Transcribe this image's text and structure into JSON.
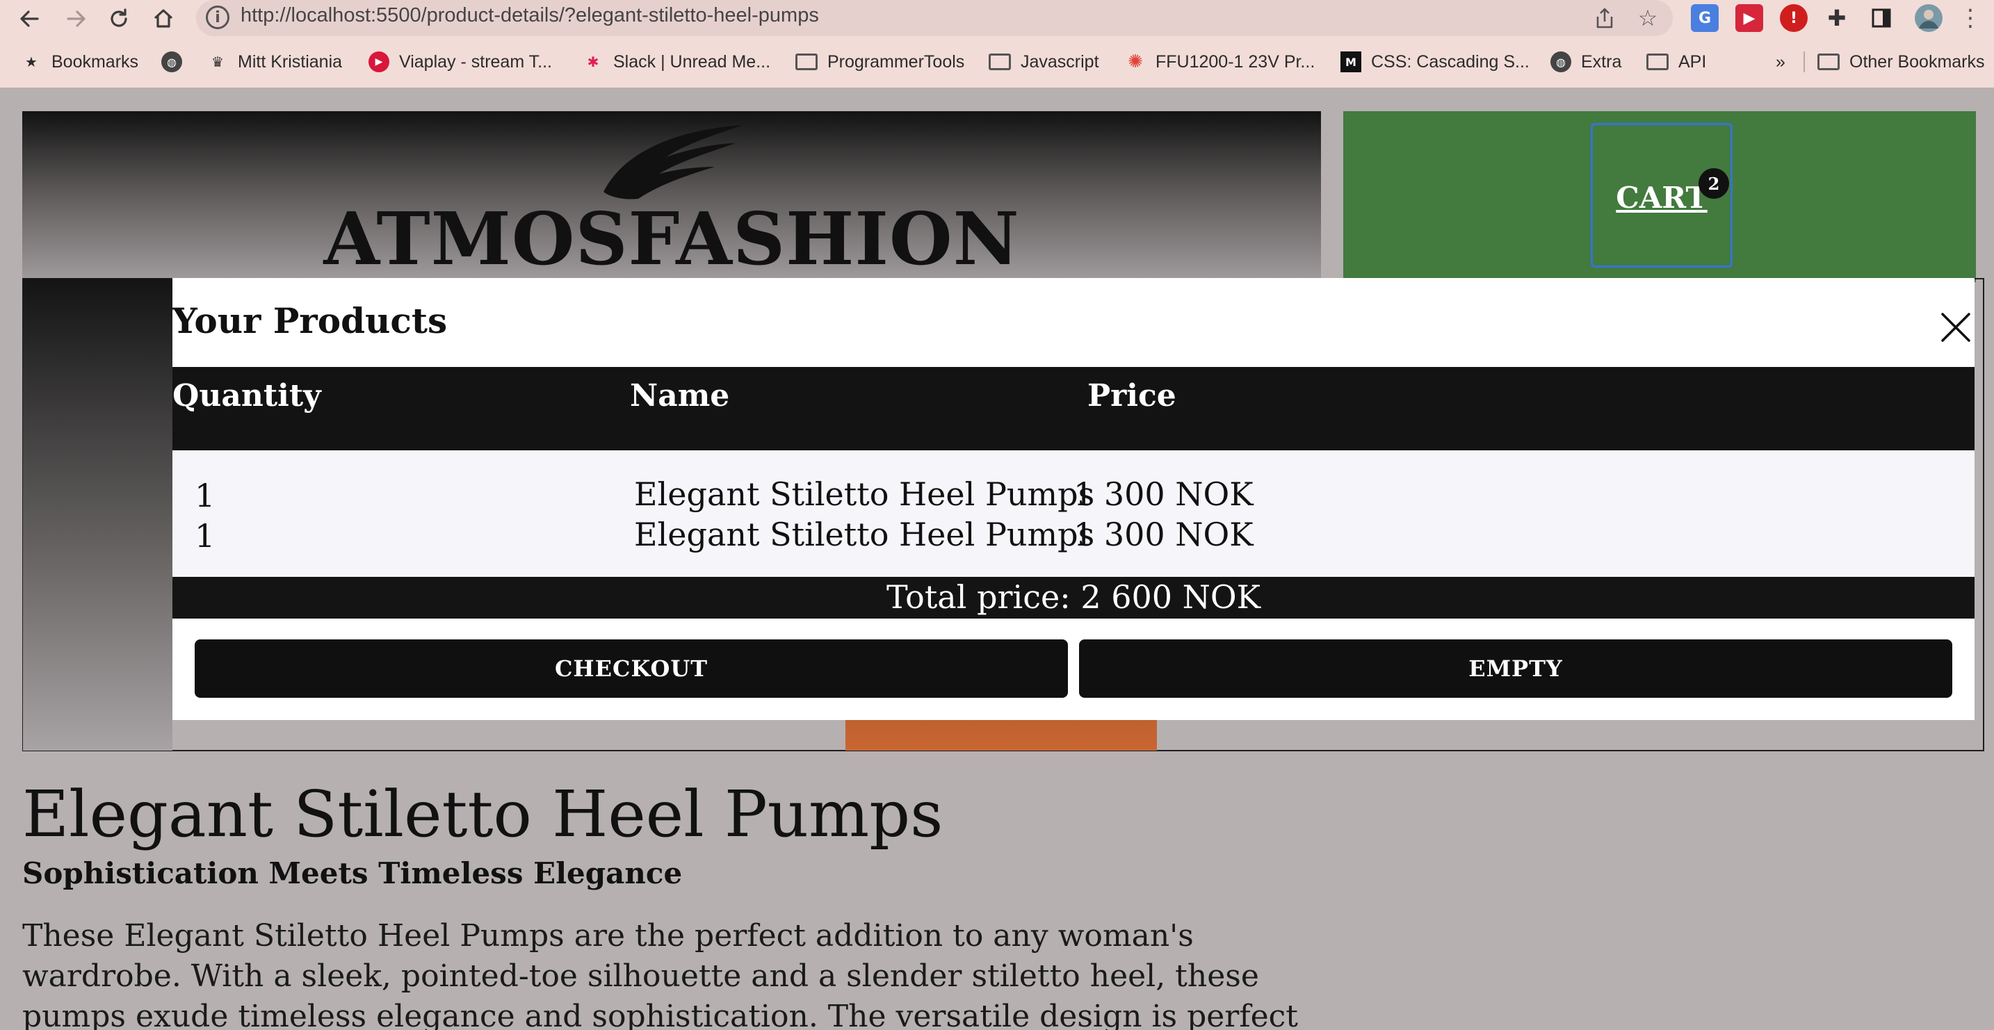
{
  "browser": {
    "url": "http://localhost:5500/product-details/?elegant-stiletto-heel-pumps",
    "nav_icons": [
      "back-arrow-icon",
      "forward-arrow-icon",
      "reload-icon",
      "home-icon"
    ],
    "bookmarks": [
      {
        "label": "Bookmarks",
        "icon": "star-icon"
      },
      {
        "label": "",
        "icon": "globe-icon"
      },
      {
        "label": "Mitt Kristiania",
        "icon": "kristiania-icon"
      },
      {
        "label": "Viaplay - stream T...",
        "icon": "viaplay-icon"
      },
      {
        "label": "Slack | Unread Me...",
        "icon": "slack-icon"
      },
      {
        "label": "ProgrammerTools",
        "icon": "folder-icon"
      },
      {
        "label": "Javascript",
        "icon": "folder-icon"
      },
      {
        "label": "FFU1200-1 23V Pr...",
        "icon": "canvas-icon"
      },
      {
        "label": "CSS: Cascading S...",
        "icon": "mdn-icon"
      },
      {
        "label": "Extra",
        "icon": "globe-icon"
      },
      {
        "label": "API",
        "icon": "folder-icon"
      }
    ],
    "overflow_label": "»",
    "other_bookmarks": "Other Bookmarks"
  },
  "site": {
    "logo_text": "ATMOSFASHION",
    "cart_label": "CART",
    "cart_count": "2"
  },
  "cart_modal": {
    "title": "Your Products",
    "headers": {
      "quantity": "Quantity",
      "name": "Name",
      "price": "Price"
    },
    "rows": [
      {
        "quantity": "1",
        "name": "Elegant Stiletto Heel Pumps",
        "price": "1 300 NOK"
      },
      {
        "quantity": "1",
        "name": "Elegant Stiletto Heel Pumps",
        "price": "1 300 NOK"
      }
    ],
    "total": "Total price: 2 600 NOK",
    "checkout_label": "CHECKOUT",
    "empty_label": "EMPTY"
  },
  "product": {
    "title": "Elegant Stiletto Heel Pumps",
    "subtitle": "Sophistication Meets Timeless Elegance",
    "description": "These Elegant Stiletto Heel Pumps are the perfect addition to any woman's wardrobe. With a sleek, pointed-toe silhouette and a slender stiletto heel, these pumps exude timeless elegance and sophistication. The versatile design is perfect for both office attire and evening events."
  },
  "colors": {
    "chrome_bg": "#f2dcd8",
    "cart_green": "#437a3e",
    "modal_dark": "#131313",
    "page_bg": "#b6b0b1"
  }
}
